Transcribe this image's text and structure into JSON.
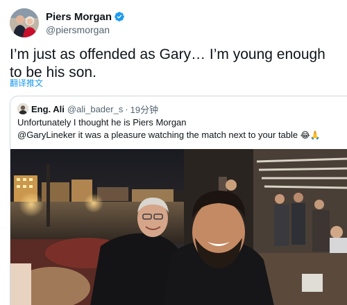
{
  "tweet": {
    "author_name": "Piers Morgan",
    "author_handle": "@piersmorgan",
    "text": "I’m just as offended as Gary… I’m young enough to be his son.",
    "translate_label": "翻译推文",
    "avatar_icon": "profile-photo",
    "verified_icon": "verified-badge-icon",
    "verified_color": "#1d9bf0"
  },
  "quote": {
    "author_name": "Eng. Ali",
    "author_handle": "@ali_bader_s",
    "separator": "·",
    "time": "19分钟",
    "line1": "Unfortunately I thought he is Piers Morgan",
    "mention": "@GaryLineker",
    "line2_rest": " it was a pleasure watching the match next to your table ",
    "emojis": "😂🙏"
  },
  "colors": {
    "text_primary": "#0f1419",
    "text_secondary": "#536471",
    "link": "#1d9bf0",
    "border": "#cfd9de"
  }
}
